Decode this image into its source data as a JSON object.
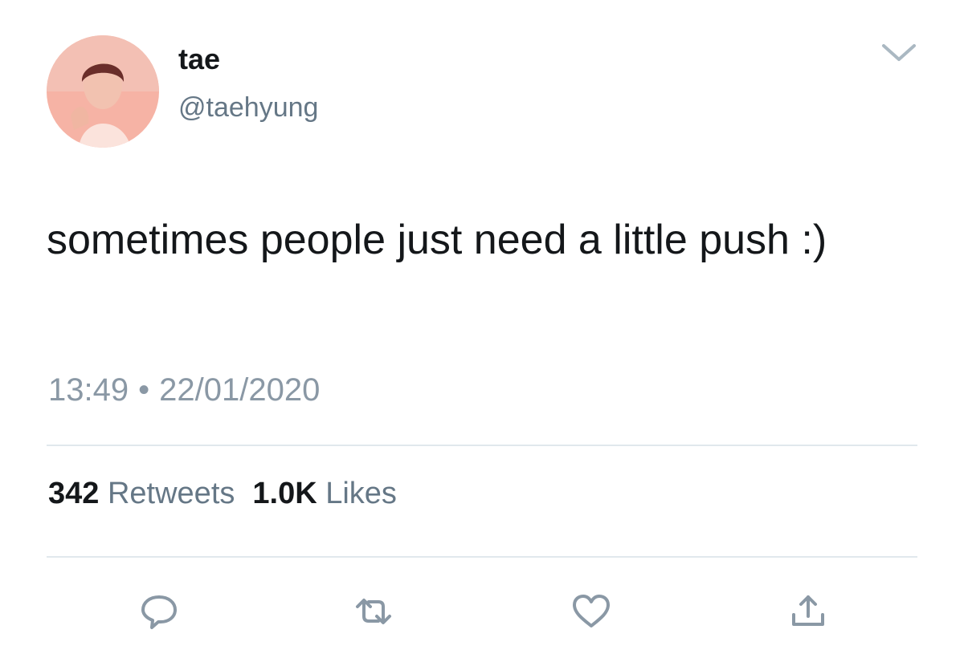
{
  "user": {
    "display_name": "tae",
    "handle": "@taehyung",
    "avatar_icon": "profile-photo"
  },
  "tweet": {
    "text": "sometimes people just need a little push :)",
    "time": "13:49",
    "separator": "•",
    "date": "22/01/2020"
  },
  "stats": {
    "retweets_count": "342",
    "retweets_label": "Retweets",
    "likes_count": "1.0K",
    "likes_label": "Likes"
  },
  "actions": {
    "reply_icon": "speech-bubble-icon",
    "retweet_icon": "retweet-arrows-icon",
    "like_icon": "heart-icon",
    "share_icon": "share-upload-icon"
  },
  "colors": {
    "text": "#14171a",
    "secondary": "#657786",
    "icon": "#8a98a5",
    "divider": "#e1e8ed",
    "avatar_tint": "#f4a89a"
  }
}
